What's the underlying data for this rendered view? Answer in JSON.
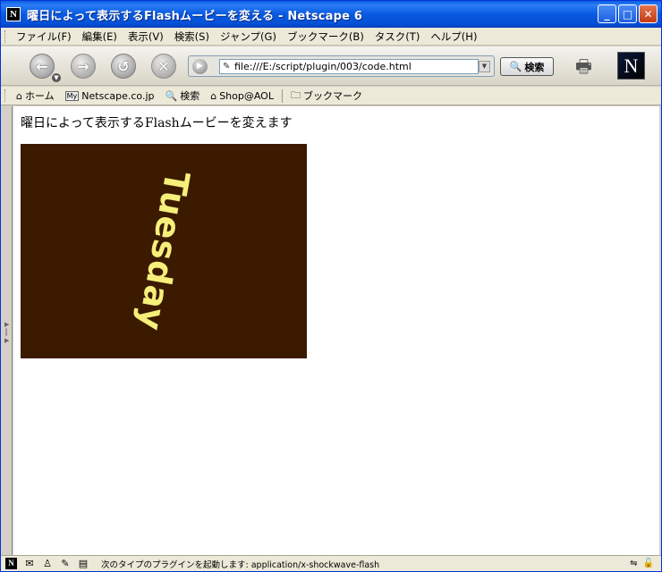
{
  "window": {
    "title": "曜日によって表示するFlashムービーを変える - Netscape 6",
    "app_icon": "N",
    "minimize": "_",
    "maximize": "□",
    "close": "✕"
  },
  "menu": [
    "ファイル(F)",
    "編集(E)",
    "表示(V)",
    "検索(S)",
    "ジャンプ(G)",
    "ブックマーク(B)",
    "タスク(T)",
    "ヘルプ(H)"
  ],
  "navigation": {
    "back_icon": "back-arrow-icon",
    "forward_icon": "forward-arrow-icon",
    "reload_icon": "reload-icon",
    "stop_icon": "stop-icon",
    "url": "file:///E:/script/plugin/003/code.html",
    "search_label": "検索",
    "logo": "N"
  },
  "personal_toolbar": {
    "home": "ホーム",
    "my_icon": "My",
    "netscape": "Netscape.co.jp",
    "search": "検索",
    "shop": "Shop@AOL",
    "bookmarks": "ブックマーク"
  },
  "content": {
    "heading": "曜日によって表示するFlashムービーを変えます",
    "flash_text": "Tuesday",
    "flash_bg": "#3b1a00",
    "flash_text_color": "#f6ef7a"
  },
  "statusbar": {
    "logo": "N",
    "message": "次のタイプのプラグインを起動します: application/x-shockwave-flash"
  }
}
